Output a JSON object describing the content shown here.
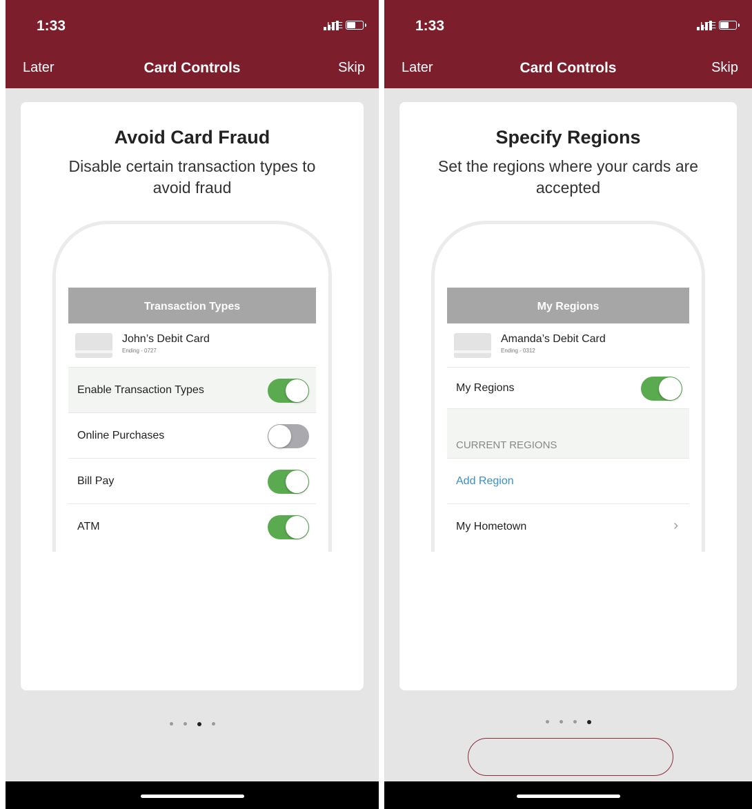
{
  "screens": [
    {
      "status": {
        "time": "1:33",
        "network": "LTE"
      },
      "nav": {
        "left": "Later",
        "title": "Card Controls",
        "right": "Skip"
      },
      "heading": "Avoid Card Fraud",
      "subheading": "Disable certain transaction types to avoid fraud",
      "mockup": {
        "header": "Transaction Types",
        "card_name": "John’s Debit Card",
        "card_ending": "Ending - 0727",
        "rows": [
          {
            "label": "Enable Transaction Types",
            "toggle": "on"
          },
          {
            "label": "Online Purchases",
            "toggle": "off"
          },
          {
            "label": "Bill Pay",
            "toggle": "on"
          },
          {
            "label": "ATM",
            "toggle": "on"
          }
        ]
      },
      "pager": {
        "count": 4,
        "active": 3
      }
    },
    {
      "status": {
        "time": "1:33",
        "network": "LTE"
      },
      "nav": {
        "left": "Later",
        "title": "Card Controls",
        "right": "Skip"
      },
      "heading": "Specify Regions",
      "subheading": "Set the regions where your cards are accepted",
      "mockup": {
        "header": "My Regions",
        "card_name": "Amanda’s Debit Card",
        "card_ending": "Ending - 0312",
        "regions_toggle_label": "My Regions",
        "regions_toggle": "on",
        "section_label": "CURRENT REGIONS",
        "add_region": "Add Region",
        "region_item": "My Hometown"
      },
      "pager": {
        "count": 4,
        "active": 4
      }
    }
  ],
  "colors": {
    "brand": "#7d1e2c",
    "toggle_on": "#5aab50",
    "toggle_off": "#a9a9ae",
    "link": "#3a8fc8"
  },
  "icons": [
    "signal-icon",
    "battery-icon",
    "card-thumbnail-icon",
    "chevron-right-icon"
  ]
}
